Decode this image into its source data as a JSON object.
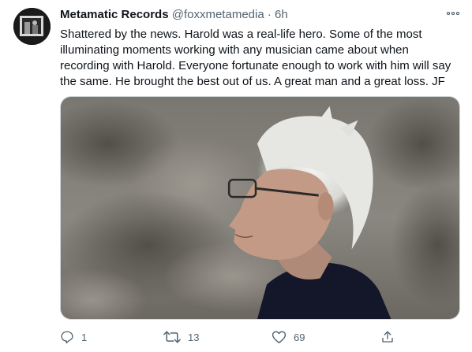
{
  "tweet": {
    "author_name": "Metamatic Records",
    "handle": "@foxxmetamedia",
    "separator": "·",
    "time": "6h",
    "text": "Shattered by the news. Harold was a real-life hero. Some of the most illuminating moments working with any musician came about when recording with Harold. Everyone fortunate enough to work with him will say the same. He brought the best out of us. A great man and a great loss. JF",
    "avatar_icon": "profile-photo",
    "media_icon": "photo-of-white-haired-man-with-glasses"
  },
  "actions": {
    "reply": {
      "icon": "reply-icon",
      "count": "1"
    },
    "retweet": {
      "icon": "retweet-icon",
      "count": "13"
    },
    "like": {
      "icon": "heart-icon",
      "count": "69"
    },
    "share": {
      "icon": "share-icon"
    }
  },
  "colors": {
    "text": "#0f1419",
    "secondary": "#536471",
    "border": "#cfd9de"
  }
}
